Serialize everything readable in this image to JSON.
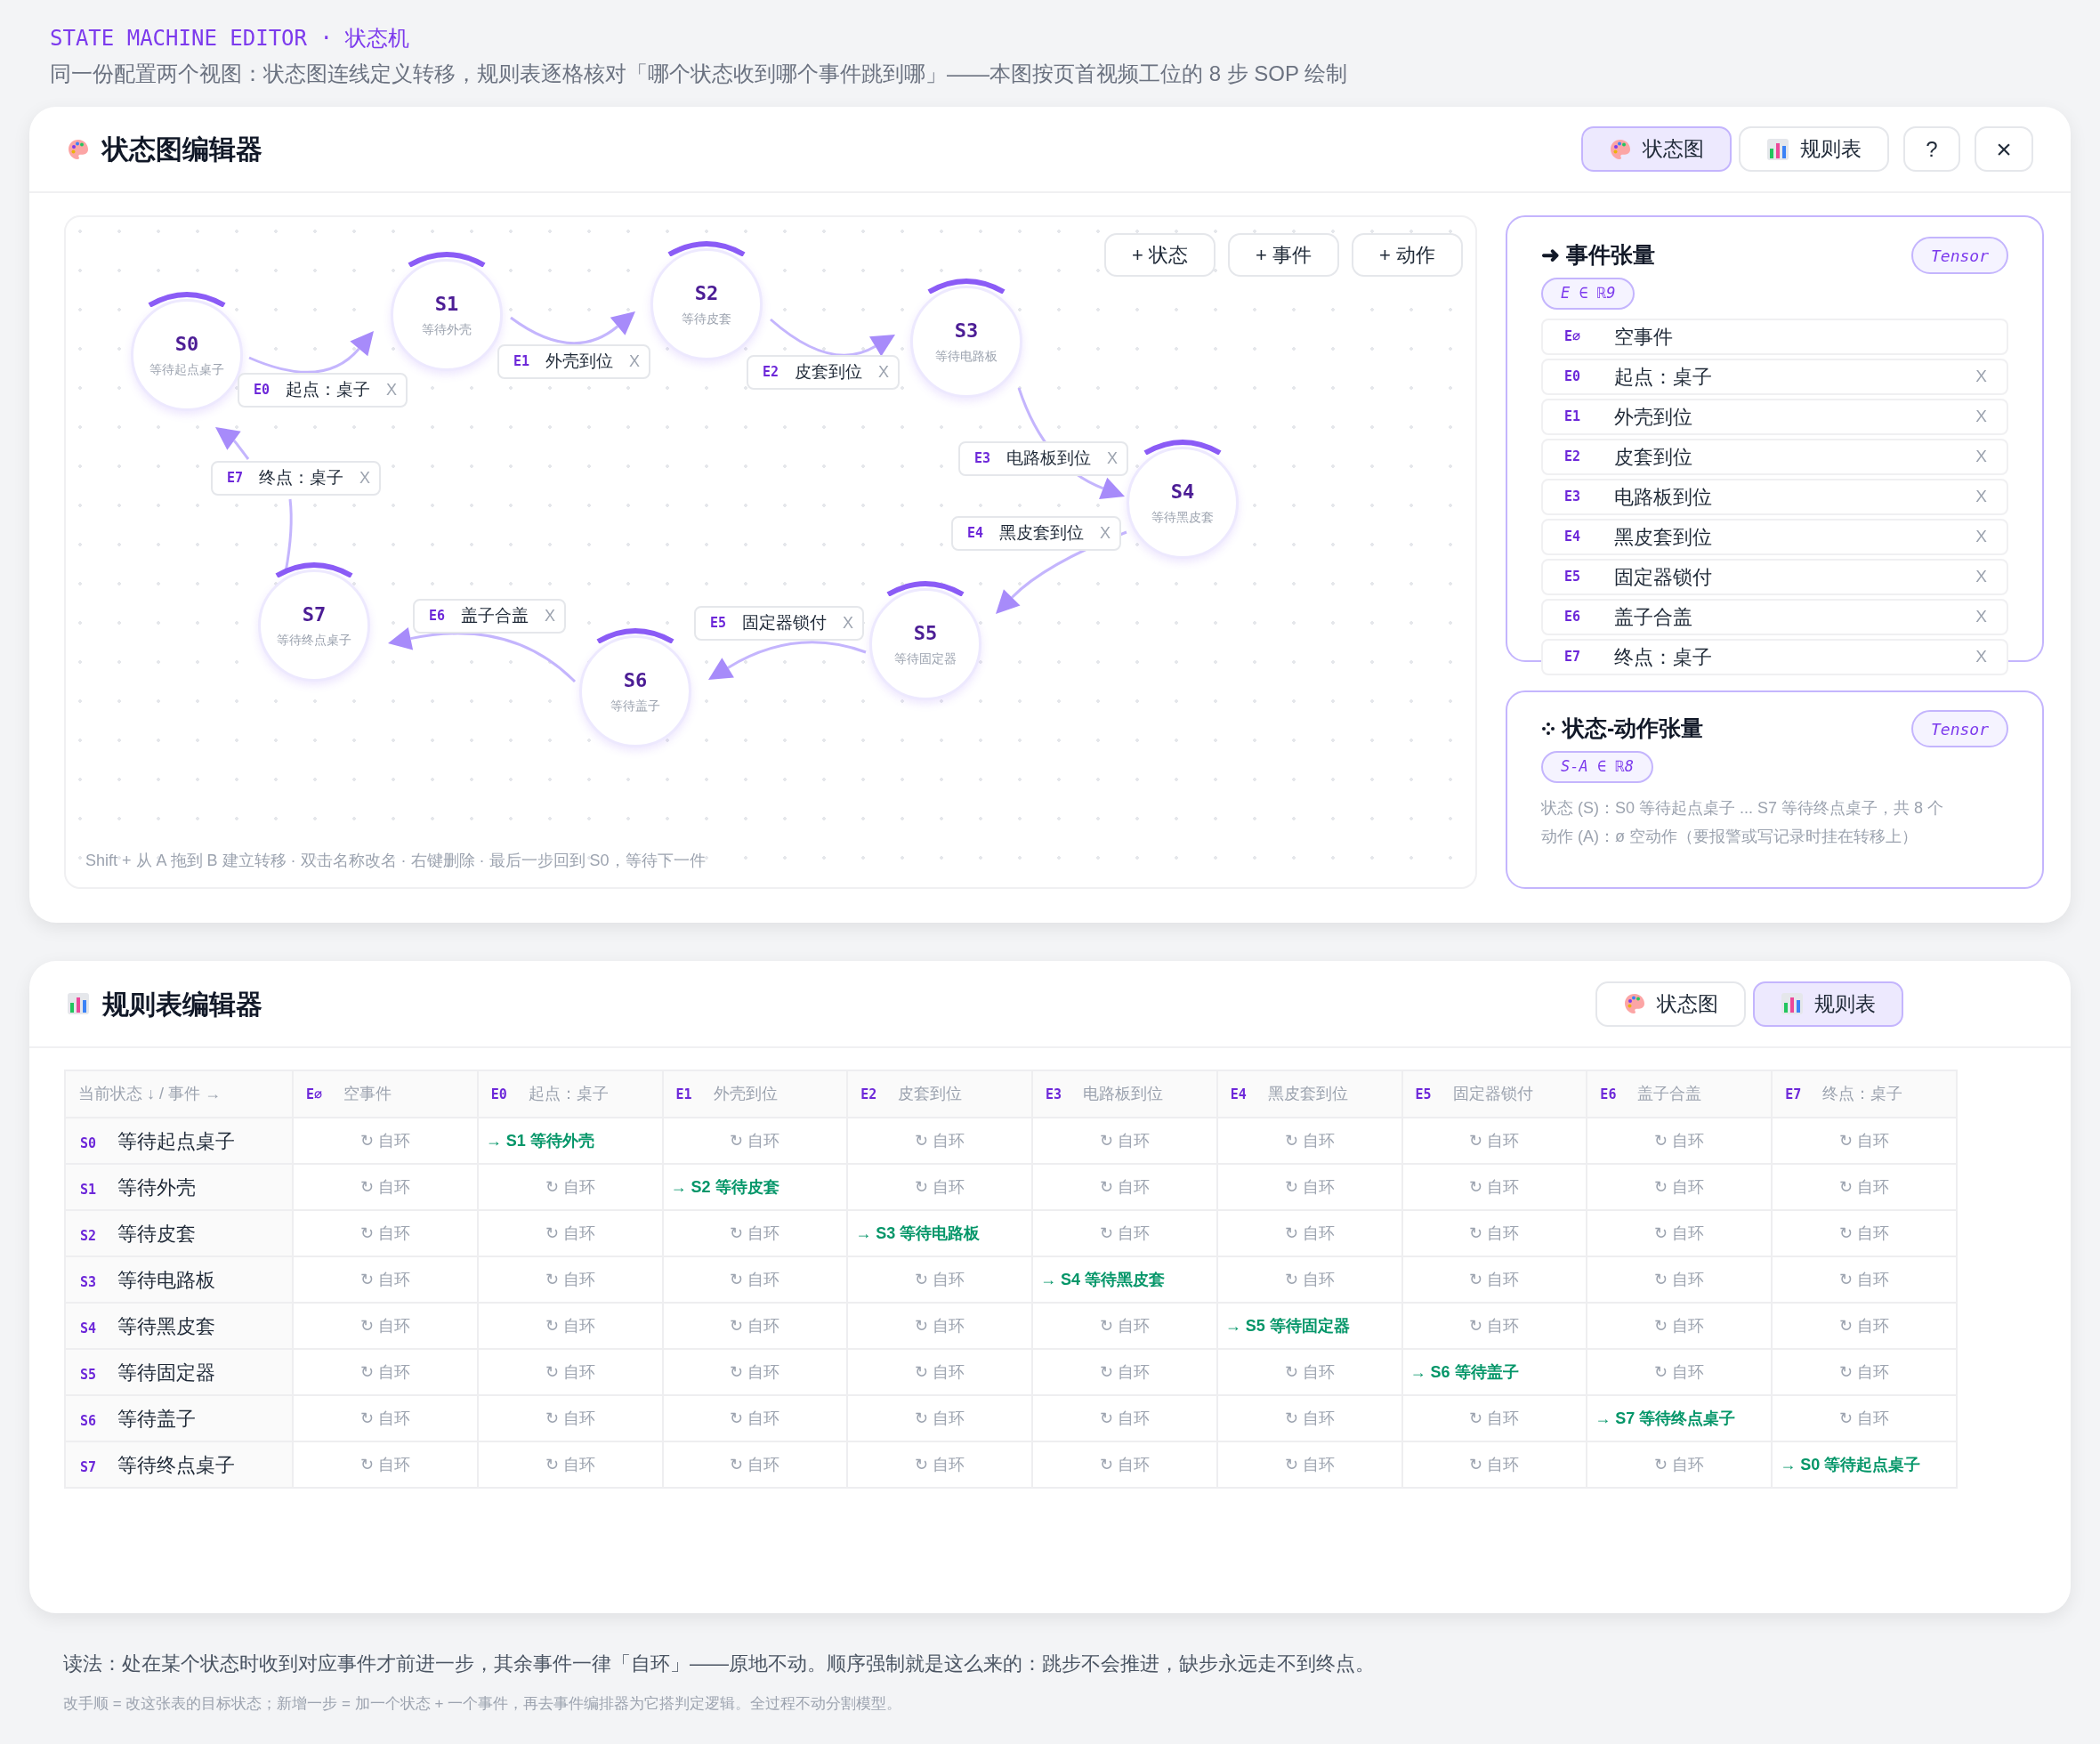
{
  "header": {
    "title": "STATE MACHINE EDITOR · 状态机",
    "subtitle": "同一份配置两个视图：状态图连线定义转移，规则表逐格核对「哪个状态收到哪个事件跳到哪」——本图按页首视频工位的 8 步 SOP 绘制"
  },
  "diagram_editor": {
    "title": "状态图编辑器",
    "view_tabs": [
      {
        "label": "状态图",
        "selected": true
      },
      {
        "label": "规则表",
        "selected": false
      }
    ],
    "help_button": "?",
    "close_button": "×",
    "canvas": {
      "add_buttons": [
        "+ 状态",
        "+ 事件",
        "+ 动作"
      ],
      "states": [
        {
          "id": "S0",
          "name": "等待起点桌子"
        },
        {
          "id": "S1",
          "name": "等待外壳"
        },
        {
          "id": "S2",
          "name": "等待皮套"
        },
        {
          "id": "S3",
          "name": "等待电路板"
        },
        {
          "id": "S4",
          "name": "等待黑皮套"
        },
        {
          "id": "S5",
          "name": "等待固定器"
        },
        {
          "id": "S6",
          "name": "等待盖子"
        },
        {
          "id": "S7",
          "name": "等待终点桌子"
        }
      ],
      "transitions": [
        {
          "event": "E0",
          "label": "起点：桌子",
          "delete": "X"
        },
        {
          "event": "E1",
          "label": "外壳到位",
          "delete": "X"
        },
        {
          "event": "E2",
          "label": "皮套到位",
          "delete": "X"
        },
        {
          "event": "E3",
          "label": "电路板到位",
          "delete": "X"
        },
        {
          "event": "E4",
          "label": "黑皮套到位",
          "delete": "X"
        },
        {
          "event": "E5",
          "label": "固定器锁付",
          "delete": "X"
        },
        {
          "event": "E6",
          "label": "盖子合盖",
          "delete": "X"
        },
        {
          "event": "E7",
          "label": "终点：桌子",
          "delete": "X"
        }
      ],
      "hint": "Shift + 从 A 拖到 B 建立转移 · 双击名称改名 · 右键删除 · 最后一步回到 S0，等待下一件"
    },
    "event_tensor": {
      "title": "➜ 事件张量",
      "badge": "Tensor",
      "formula": "E ∈ ℝ9",
      "events": [
        {
          "id": "E∅",
          "name": "空事件"
        },
        {
          "id": "E0",
          "name": "起点：桌子",
          "delete": "X"
        },
        {
          "id": "E1",
          "name": "外壳到位",
          "delete": "X"
        },
        {
          "id": "E2",
          "name": "皮套到位",
          "delete": "X"
        },
        {
          "id": "E3",
          "name": "电路板到位",
          "delete": "X"
        },
        {
          "id": "E4",
          "name": "黑皮套到位",
          "delete": "X"
        },
        {
          "id": "E5",
          "name": "固定器锁付",
          "delete": "X"
        },
        {
          "id": "E6",
          "name": "盖子合盖",
          "delete": "X"
        },
        {
          "id": "E7",
          "name": "终点：桌子",
          "delete": "X"
        }
      ]
    },
    "state_action_tensor": {
      "title": "状态-动作张量",
      "badge": "Tensor",
      "formula": "S-A ∈ ℝ8",
      "lines": [
        "状态 (S)：S0 等待起点桌子 ... S7 等待终点桌子，共 8 个",
        "动作 (A)：ø 空动作（要报警或写记录时挂在转移上）"
      ]
    }
  },
  "rule_table_editor": {
    "title": "规则表编辑器",
    "view_tabs": [
      {
        "label": "状态图",
        "selected": false
      },
      {
        "label": "规则表",
        "selected": true
      }
    ],
    "table": {
      "corner": "当前状态 ↓ / 事件 →",
      "columns": [
        {
          "id": "E∅",
          "name": "空事件"
        },
        {
          "id": "E0",
          "name": "起点：桌子"
        },
        {
          "id": "E1",
          "name": "外壳到位"
        },
        {
          "id": "E2",
          "name": "皮套到位"
        },
        {
          "id": "E3",
          "name": "电路板到位"
        },
        {
          "id": "E4",
          "name": "黑皮套到位"
        },
        {
          "id": "E5",
          "name": "固定器锁付"
        },
        {
          "id": "E6",
          "name": "盖子合盖"
        },
        {
          "id": "E7",
          "name": "终点：桌子"
        }
      ],
      "rows": [
        {
          "id": "S0",
          "name": "等待起点桌子",
          "cells": [
            {
              "kind": "self",
              "text": "↻ 自环"
            },
            {
              "kind": "next",
              "text": "→ S1 等待外壳"
            },
            {
              "kind": "self",
              "text": "↻ 自环"
            },
            {
              "kind": "self",
              "text": "↻ 自环"
            },
            {
              "kind": "self",
              "text": "↻ 自环"
            },
            {
              "kind": "self",
              "text": "↻ 自环"
            },
            {
              "kind": "self",
              "text": "↻ 自环"
            },
            {
              "kind": "self",
              "text": "↻ 自环"
            },
            {
              "kind": "self",
              "text": "↻ 自环"
            }
          ]
        },
        {
          "id": "S1",
          "name": "等待外壳",
          "cells": [
            {
              "kind": "self",
              "text": "↻ 自环"
            },
            {
              "kind": "self",
              "text": "↻ 自环"
            },
            {
              "kind": "next",
              "text": "→ S2 等待皮套"
            },
            {
              "kind": "self",
              "text": "↻ 自环"
            },
            {
              "kind": "self",
              "text": "↻ 自环"
            },
            {
              "kind": "self",
              "text": "↻ 自环"
            },
            {
              "kind": "self",
              "text": "↻ 自环"
            },
            {
              "kind": "self",
              "text": "↻ 自环"
            },
            {
              "kind": "self",
              "text": "↻ 自环"
            }
          ]
        },
        {
          "id": "S2",
          "name": "等待皮套",
          "cells": [
            {
              "kind": "self",
              "text": "↻ 自环"
            },
            {
              "kind": "self",
              "text": "↻ 自环"
            },
            {
              "kind": "self",
              "text": "↻ 自环"
            },
            {
              "kind": "next",
              "text": "→ S3 等待电路板"
            },
            {
              "kind": "self",
              "text": "↻ 自环"
            },
            {
              "kind": "self",
              "text": "↻ 自环"
            },
            {
              "kind": "self",
              "text": "↻ 自环"
            },
            {
              "kind": "self",
              "text": "↻ 自环"
            },
            {
              "kind": "self",
              "text": "↻ 自环"
            }
          ]
        },
        {
          "id": "S3",
          "name": "等待电路板",
          "cells": [
            {
              "kind": "self",
              "text": "↻ 自环"
            },
            {
              "kind": "self",
              "text": "↻ 自环"
            },
            {
              "kind": "self",
              "text": "↻ 自环"
            },
            {
              "kind": "self",
              "text": "↻ 自环"
            },
            {
              "kind": "next",
              "text": "→ S4 等待黑皮套"
            },
            {
              "kind": "self",
              "text": "↻ 自环"
            },
            {
              "kind": "self",
              "text": "↻ 自环"
            },
            {
              "kind": "self",
              "text": "↻ 自环"
            },
            {
              "kind": "self",
              "text": "↻ 自环"
            }
          ]
        },
        {
          "id": "S4",
          "name": "等待黑皮套",
          "cells": [
            {
              "kind": "self",
              "text": "↻ 自环"
            },
            {
              "kind": "self",
              "text": "↻ 自环"
            },
            {
              "kind": "self",
              "text": "↻ 自环"
            },
            {
              "kind": "self",
              "text": "↻ 自环"
            },
            {
              "kind": "self",
              "text": "↻ 自环"
            },
            {
              "kind": "next",
              "text": "→ S5 等待固定器"
            },
            {
              "kind": "self",
              "text": "↻ 自环"
            },
            {
              "kind": "self",
              "text": "↻ 自环"
            },
            {
              "kind": "self",
              "text": "↻ 自环"
            }
          ]
        },
        {
          "id": "S5",
          "name": "等待固定器",
          "cells": [
            {
              "kind": "self",
              "text": "↻ 自环"
            },
            {
              "kind": "self",
              "text": "↻ 自环"
            },
            {
              "kind": "self",
              "text": "↻ 自环"
            },
            {
              "kind": "self",
              "text": "↻ 自环"
            },
            {
              "kind": "self",
              "text": "↻ 自环"
            },
            {
              "kind": "self",
              "text": "↻ 自环"
            },
            {
              "kind": "next",
              "text": "→ S6 等待盖子"
            },
            {
              "kind": "self",
              "text": "↻ 自环"
            },
            {
              "kind": "self",
              "text": "↻ 自环"
            }
          ]
        },
        {
          "id": "S6",
          "name": "等待盖子",
          "cells": [
            {
              "kind": "self",
              "text": "↻ 自环"
            },
            {
              "kind": "self",
              "text": "↻ 自环"
            },
            {
              "kind": "self",
              "text": "↻ 自环"
            },
            {
              "kind": "self",
              "text": "↻ 自环"
            },
            {
              "kind": "self",
              "text": "↻ 自环"
            },
            {
              "kind": "self",
              "text": "↻ 自环"
            },
            {
              "kind": "self",
              "text": "↻ 自环"
            },
            {
              "kind": "next",
              "text": "→ S7 等待终点桌子"
            },
            {
              "kind": "self",
              "text": "↻ 自环"
            }
          ]
        },
        {
          "id": "S7",
          "name": "等待终点桌子",
          "cells": [
            {
              "kind": "self",
              "text": "↻ 自环"
            },
            {
              "kind": "self",
              "text": "↻ 自环"
            },
            {
              "kind": "self",
              "text": "↻ 自环"
            },
            {
              "kind": "self",
              "text": "↻ 自环"
            },
            {
              "kind": "self",
              "text": "↻ 自环"
            },
            {
              "kind": "self",
              "text": "↻ 自环"
            },
            {
              "kind": "self",
              "text": "↻ 自环"
            },
            {
              "kind": "self",
              "text": "↻ 自环"
            },
            {
              "kind": "next",
              "text": "→ S0 等待起点桌子"
            }
          ]
        }
      ]
    }
  },
  "footer": {
    "note": "读法：处在某个状态时收到对应事件才前进一步，其余事件一律「自环」——原地不动。顺序强制就是这么来的：跳步不会推进，缺步永远走不到终点。",
    "hint": "改手顺 = 改这张表的目标状态；新增一步 = 加一个状态 + 一个事件，再去事件编排器为它搭判定逻辑。全过程不动分割模型。"
  }
}
